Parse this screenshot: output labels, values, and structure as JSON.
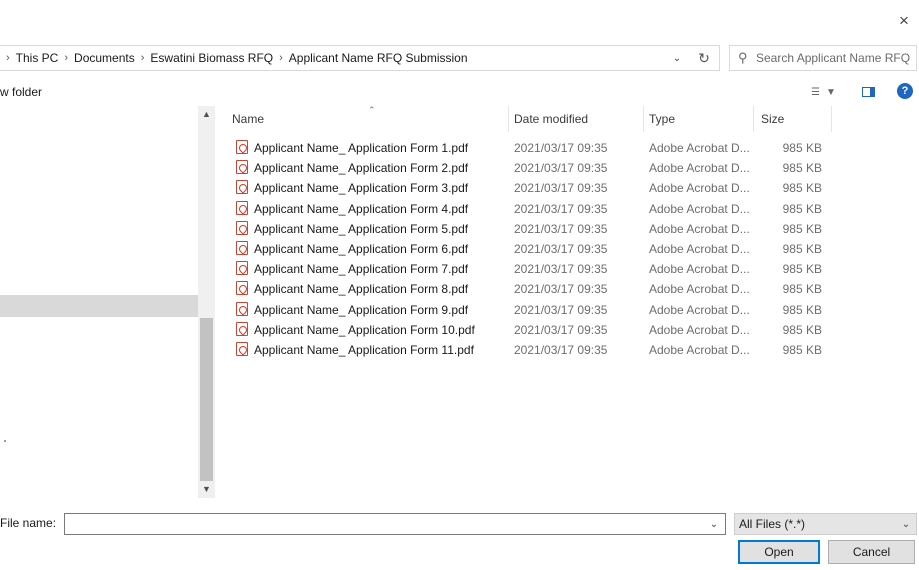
{
  "window": {
    "close_glyph": "×"
  },
  "address": {
    "lead_glyph": "▸",
    "crumbs": [
      "This PC",
      "Documents",
      "Eswatini Biomass RFQ",
      "Applicant Name RFQ Submission"
    ],
    "separator": "›"
  },
  "search": {
    "placeholder": "Search Applicant Name RFQ ..."
  },
  "toolbar": {
    "new_folder_label": "w folder"
  },
  "columns": {
    "name": "Name",
    "date": "Date modified",
    "type": "Type",
    "size": "Size"
  },
  "files": [
    {
      "name": "Applicant Name_ Application Form 1.pdf",
      "date": "2021/03/17 09:35",
      "type": "Adobe Acrobat D...",
      "size": "985 KB"
    },
    {
      "name": "Applicant Name_ Application Form 2.pdf",
      "date": "2021/03/17 09:35",
      "type": "Adobe Acrobat D...",
      "size": "985 KB"
    },
    {
      "name": "Applicant Name_ Application Form 3.pdf",
      "date": "2021/03/17 09:35",
      "type": "Adobe Acrobat D...",
      "size": "985 KB"
    },
    {
      "name": "Applicant Name_ Application Form 4.pdf",
      "date": "2021/03/17 09:35",
      "type": "Adobe Acrobat D...",
      "size": "985 KB"
    },
    {
      "name": "Applicant Name_ Application Form 5.pdf",
      "date": "2021/03/17 09:35",
      "type": "Adobe Acrobat D...",
      "size": "985 KB"
    },
    {
      "name": "Applicant Name_ Application Form 6.pdf",
      "date": "2021/03/17 09:35",
      "type": "Adobe Acrobat D...",
      "size": "985 KB"
    },
    {
      "name": "Applicant Name_ Application Form 7.pdf",
      "date": "2021/03/17 09:35",
      "type": "Adobe Acrobat D...",
      "size": "985 KB"
    },
    {
      "name": "Applicant Name_ Application Form 8.pdf",
      "date": "2021/03/17 09:35",
      "type": "Adobe Acrobat D...",
      "size": "985 KB"
    },
    {
      "name": "Applicant Name_ Application Form 9.pdf",
      "date": "2021/03/17 09:35",
      "type": "Adobe Acrobat D...",
      "size": "985 KB"
    },
    {
      "name": "Applicant Name_ Application Form 10.pdf",
      "date": "2021/03/17 09:35",
      "type": "Adobe Acrobat D...",
      "size": "985 KB"
    },
    {
      "name": "Applicant Name_ Application Form 11.pdf",
      "date": "2021/03/17 09:35",
      "type": "Adobe Acrobat D...",
      "size": "985 KB"
    }
  ],
  "footer": {
    "filename_label": "File name:",
    "filename_value": "",
    "filetype_selected": "All Files (*.*)",
    "open_label": "Open",
    "cancel_label": "Cancel"
  },
  "colors": {
    "accent": "#0078d7",
    "pdf_red": "#d2382a",
    "selection_gray": "#d9d9d9"
  }
}
